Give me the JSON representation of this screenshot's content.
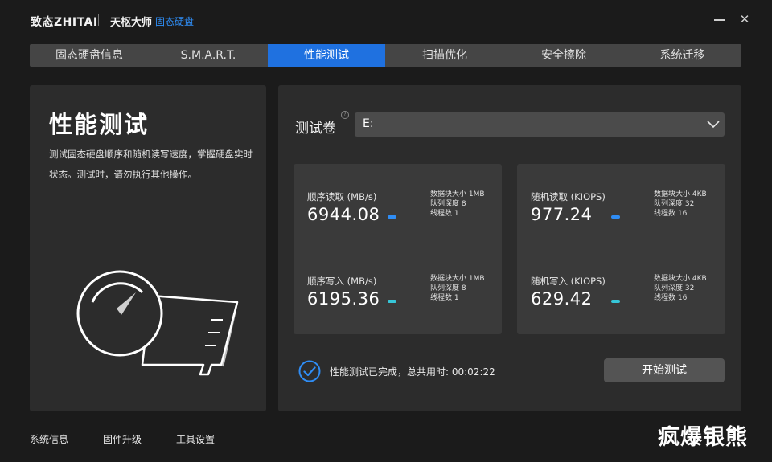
{
  "title_bar": {
    "brand": "致态ZHITAI",
    "app_name": "天枢大师",
    "app_subtitle": "固态硬盘",
    "minimize_label": "minimize",
    "close_label": "✕"
  },
  "tabs": [
    {
      "label": "固态硬盘信息",
      "active": false
    },
    {
      "label": "S.M.A.R.T.",
      "active": false
    },
    {
      "label": "性能测试",
      "active": true
    },
    {
      "label": "扫描优化",
      "active": false
    },
    {
      "label": "安全擦除",
      "active": false
    },
    {
      "label": "系统迁移",
      "active": false
    }
  ],
  "intro": {
    "title": "性能测试",
    "description": "测试固态硬盘顺序和随机读写速度，掌握硬盘实时状态。测试时，请勿执行其他操作。"
  },
  "volume": {
    "label": "测试卷",
    "help_icon": "?",
    "selected": "E:"
  },
  "metrics": {
    "seq_read": {
      "label": "顺序读取 (MB/s)",
      "value": "6944.08",
      "p1": "数据块大小 1MB",
      "p2": "队列深度 8",
      "p3": "线程数 1",
      "bar_color": "#2f8df5"
    },
    "rand_read": {
      "label": "随机读取 (KIOPS)",
      "value": "977.24",
      "p1": "数据块大小 4KB",
      "p2": "队列深度 32",
      "p3": "线程数 16",
      "bar_color": "#2f8df5"
    },
    "seq_write": {
      "label": "顺序写入 (MB/s)",
      "value": "6195.36",
      "p1": "数据块大小 1MB",
      "p2": "队列深度 8",
      "p3": "线程数 1",
      "bar_color": "#36c6d8"
    },
    "rand_write": {
      "label": "随机写入 (KIOPS)",
      "value": "629.42",
      "p1": "数据块大小 4KB",
      "p2": "队列深度 32",
      "p3": "线程数 16",
      "bar_color": "#36c6d8"
    }
  },
  "status": {
    "text": "性能测试已完成，总共用时: 00:02:22",
    "icon": "check-circle-icon"
  },
  "start_button": {
    "label": "开始测试"
  },
  "footer": [
    {
      "label": "系统信息"
    },
    {
      "label": "固件升级"
    },
    {
      "label": "工具设置"
    }
  ],
  "watermark": "疯爆银熊",
  "colors": {
    "accent": "#1f71e0",
    "cyan": "#36c6d8"
  }
}
